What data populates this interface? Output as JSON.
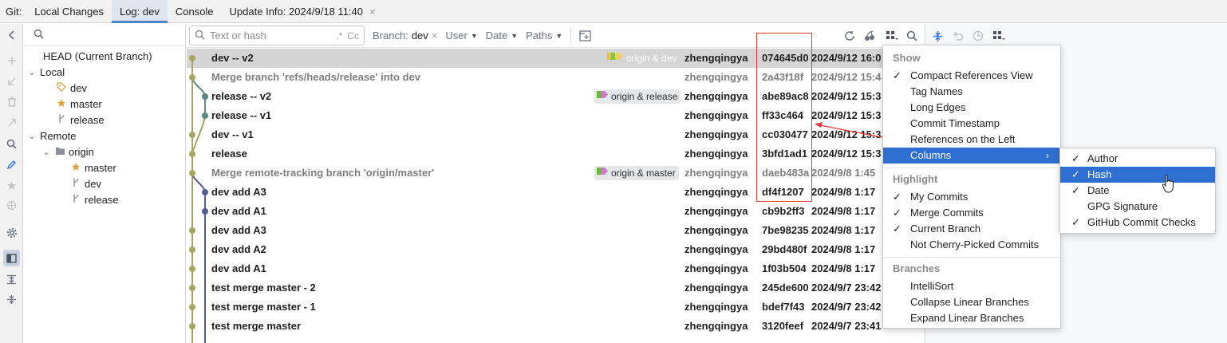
{
  "topbar": {
    "git_label": "Git:",
    "tabs": [
      {
        "label": "Local Changes"
      },
      {
        "label": "Log: dev"
      },
      {
        "label": "Console"
      },
      {
        "label": "Update Info: 2024/9/18 11:40"
      }
    ],
    "close_glyph": "×"
  },
  "left_toolbar": {
    "icons": [
      "chevron-left-icon",
      "plus-icon",
      "arrow-down-left-icon",
      "trash-icon",
      "merge-icon",
      "search-icon",
      "edit-icon",
      "star-icon",
      "target-icon",
      "settings-icon",
      "panel-icon",
      "expand-icon",
      "collapse-icon"
    ]
  },
  "branches": {
    "head_label": "HEAD (Current Branch)",
    "local_label": "Local",
    "local_items": [
      {
        "label": "dev",
        "icon": "tag-icon"
      },
      {
        "label": "master",
        "icon": "star-icon"
      },
      {
        "label": "release",
        "icon": "branch-icon"
      }
    ],
    "remote_label": "Remote",
    "origin_label": "origin",
    "origin_items": [
      {
        "label": "master",
        "icon": "star-icon"
      },
      {
        "label": "dev",
        "icon": "branch-icon"
      },
      {
        "label": "release",
        "icon": "branch-icon"
      }
    ]
  },
  "filter": {
    "search_placeholder": "Text or hash",
    "regex_glyph": ".*",
    "case_glyph": "Cc",
    "branch_label": "Branch:",
    "branch_value": "dev",
    "user_label": "User",
    "date_label": "Date",
    "paths_label": "Paths"
  },
  "commits": [
    {
      "message": "dev -- v2",
      "refs": "origin & dev",
      "author": "zhengqingya",
      "hash": "074645d0",
      "date": "2024/9/12 16:0",
      "merge": false
    },
    {
      "message": "Merge branch 'refs/heads/release' into dev",
      "refs": "",
      "author": "zhengqingya",
      "hash": "2a43f18f",
      "date": "2024/9/12 15:4",
      "merge": true
    },
    {
      "message": "release -- v2",
      "refs": "origin & release",
      "author": "zhengqingya",
      "hash": "abe89ac8",
      "date": "2024/9/12 15:3",
      "merge": false
    },
    {
      "message": "release -- v1",
      "refs": "",
      "author": "zhengqingya",
      "hash": "ff33c464",
      "date": "2024/9/12 15:3",
      "merge": false
    },
    {
      "message": "dev -- v1",
      "refs": "",
      "author": "zhengqingya",
      "hash": "cc030477",
      "date": "2024/9/12 15:3",
      "merge": false
    },
    {
      "message": "release",
      "refs": "",
      "author": "zhengqingya",
      "hash": "3bfd1ad1",
      "date": "2024/9/12 15:3",
      "merge": false
    },
    {
      "message": "Merge remote-tracking branch 'origin/master'",
      "refs": "origin & master",
      "author": "zhengqingya",
      "hash": "daeb483a",
      "date": "2024/9/8 1:45",
      "merge": true
    },
    {
      "message": "dev add A3",
      "refs": "",
      "author": "zhengqingya",
      "hash": "df4f1207",
      "date": "2024/9/8 1:17",
      "merge": false
    },
    {
      "message": "dev add A1",
      "refs": "",
      "author": "zhengqingya",
      "hash": "cb9b2ff3",
      "date": "2024/9/8 1:17",
      "merge": false
    },
    {
      "message": "dev add A3",
      "refs": "",
      "author": "zhengqingya",
      "hash": "7be98235",
      "date": "2024/9/8 1:17",
      "merge": false
    },
    {
      "message": "dev add A2",
      "refs": "",
      "author": "zhengqingya",
      "hash": "29bd480f",
      "date": "2024/9/8 1:17",
      "merge": false
    },
    {
      "message": "dev add A1",
      "refs": "",
      "author": "zhengqingya",
      "hash": "1f03b504",
      "date": "2024/9/8 1:17",
      "merge": false
    },
    {
      "message": "test merge master - 2",
      "refs": "",
      "author": "zhengqingya",
      "hash": "245de600",
      "date": "2024/9/7 23:42",
      "merge": false
    },
    {
      "message": "test merge master - 1",
      "refs": "",
      "author": "zhengqingya",
      "hash": "bdef7f43",
      "date": "2024/9/7 23:42",
      "merge": false
    },
    {
      "message": "test merge master",
      "refs": "",
      "author": "zhengqingya",
      "hash": "3120feef",
      "date": "2024/9/7 23:41",
      "merge": false
    }
  ],
  "menu": {
    "show_label": "Show",
    "show_items": [
      {
        "label": "Compact References View",
        "checked": true
      },
      {
        "label": "Tag Names",
        "checked": false
      },
      {
        "label": "Long Edges",
        "checked": false
      },
      {
        "label": "Commit Timestamp",
        "checked": false
      },
      {
        "label": "References on the Left",
        "checked": false
      }
    ],
    "columns_label": "Columns",
    "highlight_label": "Highlight",
    "highlight_items": [
      {
        "label": "My Commits",
        "checked": true
      },
      {
        "label": "Merge Commits",
        "checked": true
      },
      {
        "label": "Current Branch",
        "checked": true
      },
      {
        "label": "Not Cherry-Picked Commits",
        "checked": false
      }
    ],
    "branches_label": "Branches",
    "branches_items": [
      {
        "label": "IntelliSort"
      },
      {
        "label": "Collapse Linear Branches"
      },
      {
        "label": "Expand Linear Branches"
      }
    ]
  },
  "columns_submenu": [
    {
      "label": "Author",
      "checked": true
    },
    {
      "label": "Hash",
      "checked": true
    },
    {
      "label": "Date",
      "checked": true
    },
    {
      "label": "GPG Signature",
      "checked": false
    },
    {
      "label": "GitHub Commit Checks",
      "checked": true
    }
  ],
  "glyphs": {
    "check": "✓",
    "submenu_arrow": "›"
  },
  "colors": {
    "accent": "#3574f0",
    "menu_highlight": "#2f6fd1",
    "annotation": "#e53935",
    "graph_olive": "#a9a463",
    "graph_teal": "#5f8a80",
    "graph_navy": "#555c8f"
  }
}
